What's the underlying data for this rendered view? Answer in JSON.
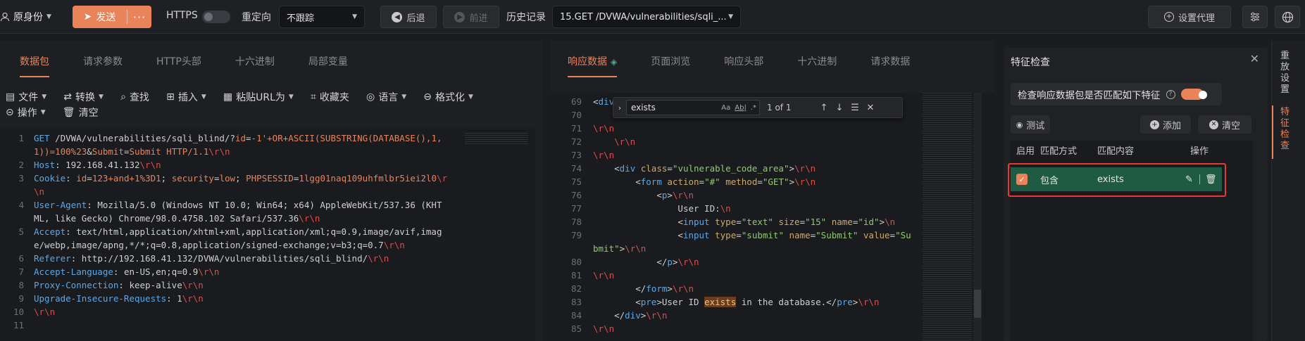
{
  "topbar": {
    "identity": "原身份",
    "send": "发送",
    "send_more": "···",
    "https_label": "HTTPS",
    "https_on": false,
    "redirect_label": "重定向",
    "redirect_value": "不跟踪",
    "back": "后退",
    "forward": "前进",
    "history_label": "历史记录",
    "history_value": "15.GET /DVWA/vulnerabilities/sqli_...",
    "proxy": "设置代理"
  },
  "request": {
    "tabs": [
      "数据包",
      "请求参数",
      "HTTP头部",
      "十六进制",
      "局部变量"
    ],
    "toolbar": [
      "文件",
      "转换",
      "查找",
      "插入",
      "粘贴URL为",
      "收藏夹",
      "语言",
      "格式化",
      "操作",
      "清空"
    ],
    "line_numbers": [
      "1",
      "",
      "2",
      "3",
      "",
      "4",
      "",
      "5",
      "",
      "6",
      "7",
      "8",
      "9",
      "10",
      "11"
    ]
  },
  "response": {
    "tabs": [
      "响应数据",
      "页面浏览",
      "响应头部",
      "十六进制",
      "请求数据"
    ],
    "search_value": "exists",
    "search_aa": "Aa",
    "search_ab": "Ab|",
    "search_re": ".*",
    "search_count": "1 of 1",
    "line_numbers": [
      "69",
      "70",
      "71",
      "72",
      "73",
      "74",
      "75",
      "76",
      "77",
      "78",
      "79",
      "",
      "80",
      "81",
      "82",
      "83",
      "84",
      "85"
    ]
  },
  "feature": {
    "title": "特征检查",
    "match_label": "检查响应数据包是否匹配如下特征",
    "match_on": true,
    "test": "测试",
    "add": "添加",
    "clear": "清空",
    "columns": [
      "启用",
      "匹配方式",
      "匹配内容",
      "操作"
    ],
    "rows": [
      {
        "enabled": true,
        "mode": "包含",
        "content": "exists"
      }
    ]
  },
  "side_tabs": [
    "重放设置",
    "特征检查"
  ],
  "colors": {
    "accent": "#e8835a",
    "highlight": "#e53935"
  }
}
